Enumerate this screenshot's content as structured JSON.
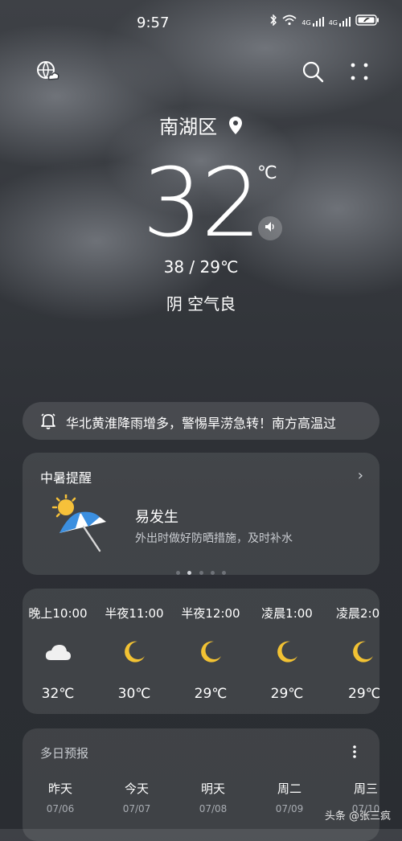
{
  "status": {
    "time": "9:57",
    "net1": "4G",
    "net2": "4G"
  },
  "header": {
    "city": "南湖区"
  },
  "current": {
    "temp": "32",
    "unit": "℃",
    "range": "38 / 29℃",
    "condition": "阴 空气良"
  },
  "alert": {
    "text": "华北黄淮降雨增多，警惕旱涝急转！南方高温过"
  },
  "heat_card": {
    "title": "中暑提醒",
    "level": "易发生",
    "tip": "外出时做好防晒措施，及时补水"
  },
  "hourly": [
    {
      "label": "晚上10:00",
      "temp": "32℃",
      "icon": "cloud"
    },
    {
      "label": "半夜11:00",
      "temp": "30℃",
      "icon": "moon"
    },
    {
      "label": "半夜12:00",
      "temp": "29℃",
      "icon": "moon"
    },
    {
      "label": "凌晨1:00",
      "temp": "29℃",
      "icon": "moon"
    },
    {
      "label": "凌晨2:0",
      "temp": "29℃",
      "icon": "moon"
    }
  ],
  "multi_day": {
    "title": "多日预报",
    "days": [
      {
        "name": "昨天",
        "date": "07/06"
      },
      {
        "name": "今天",
        "date": "07/07"
      },
      {
        "name": "明天",
        "date": "07/08"
      },
      {
        "name": "周二",
        "date": "07/09"
      },
      {
        "name": "周三",
        "date": "07/10"
      }
    ]
  },
  "watermark": "头条 @张三疯",
  "colors": {
    "sun": "#f6c13a",
    "moon": "#f2c233",
    "umbrella": "#3b8fe0"
  }
}
